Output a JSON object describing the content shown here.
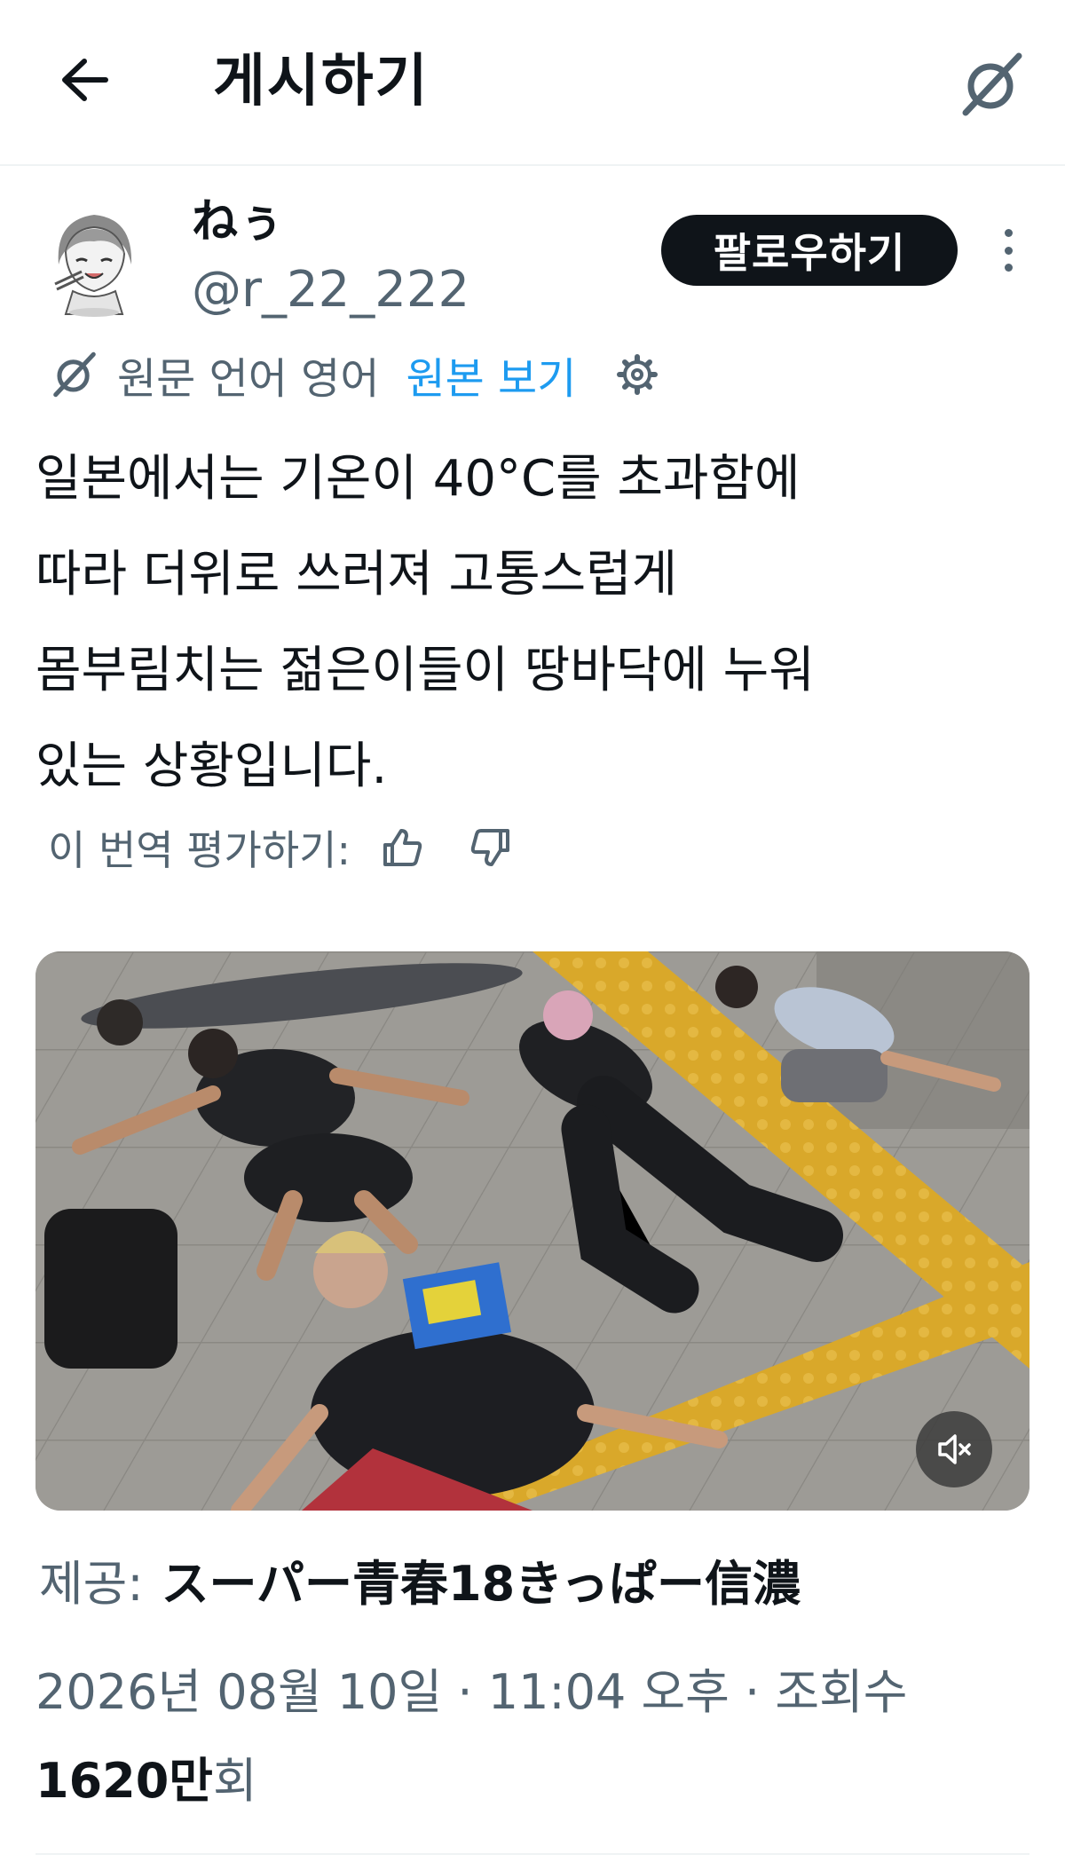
{
  "header": {
    "title": "게시하기",
    "back_icon": "arrow-left-icon",
    "grok_icon": "grok-slash-icon"
  },
  "author": {
    "display_name": "ねぅ",
    "handle": "@r_22_222",
    "follow_label": "팔로우하기",
    "more_icon": "more-vertical-icon"
  },
  "translation": {
    "notice": "원문 언어 영어",
    "show_original_label": "원본 보기",
    "settings_icon": "gear-icon"
  },
  "tweet": {
    "lines": [
      "일본에서는 기온이 40°C를 초과함에",
      "따라 더위로 쓰러져 고통스럽게",
      "몸부림치는 젊은이들이 땅바닥에 누워",
      "있는 상황입니다."
    ]
  },
  "rating": {
    "label": "이 번역 평가하기:",
    "up_icon": "thumbs-up-icon",
    "down_icon": "thumbs-down-icon"
  },
  "media": {
    "type": "video",
    "mute_icon": "speaker-muted-icon"
  },
  "credit": {
    "label": "제공:",
    "source": "スーパー青春18きっぱー信濃"
  },
  "meta": {
    "timestamp": "2026년 08월 10일 · 11:04 오후 · 조회수",
    "views_count": "1620만",
    "views_unit": "회"
  },
  "colors": {
    "text_primary": "#0f1419",
    "text_secondary": "#536471",
    "link": "#1d9bf0",
    "follow_bg": "#0f1419"
  }
}
